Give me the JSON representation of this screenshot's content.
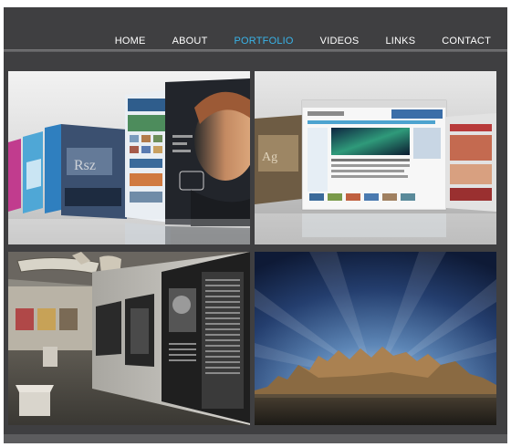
{
  "nav": {
    "items": [
      {
        "label": "HOME"
      },
      {
        "label": "ABOUT"
      },
      {
        "label": "PORTFOLIO"
      },
      {
        "label": "VIDEOS"
      },
      {
        "label": "LINKS"
      },
      {
        "label": "CONTACT"
      }
    ],
    "active_index": 2,
    "active_color": "#39b3e8"
  },
  "colors": {
    "background": "#3f3f41",
    "nav_text": "#ffffff"
  },
  "gallery": {
    "tiles": [
      {
        "name": "portfolio-thumb-book-covers"
      },
      {
        "name": "portfolio-thumb-websites"
      },
      {
        "name": "portfolio-thumb-gallery-exhibition"
      },
      {
        "name": "portfolio-thumb-mountain-landscape"
      }
    ]
  }
}
